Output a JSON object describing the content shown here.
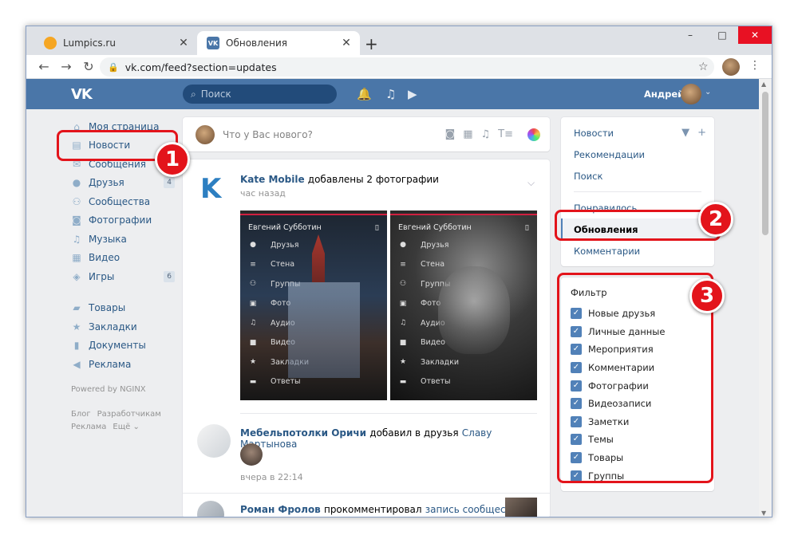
{
  "browser": {
    "tabs": [
      {
        "title": "Lumpics.ru",
        "close": "✕"
      },
      {
        "title": "Обновления",
        "close": "✕"
      }
    ],
    "new_tab": "+",
    "window_controls": {
      "minimize": "–",
      "maximize": "□",
      "close": "✕"
    },
    "nav": {
      "back": "←",
      "forward": "→",
      "reload": "↻"
    },
    "url": "vk.com/feed?section=updates",
    "star": "☆",
    "menu": "⋮"
  },
  "vk_header": {
    "logo": "VK",
    "search_placeholder": "Поиск",
    "username": "Андрей",
    "caret": "⌄",
    "icons": {
      "bell": "🔔",
      "music": "♫",
      "video": "▶"
    }
  },
  "left_menu": {
    "items": [
      {
        "label": "Моя страница",
        "icon": "home-icon",
        "count": ""
      },
      {
        "label": "Новости",
        "icon": "news-icon",
        "count": ""
      },
      {
        "label": "Сообщения",
        "icon": "messages-icon",
        "count": ""
      },
      {
        "label": "Друзья",
        "icon": "friends-icon",
        "count": "4"
      },
      {
        "label": "Сообщества",
        "icon": "communities-icon",
        "count": ""
      },
      {
        "label": "Фотографии",
        "icon": "camera-icon",
        "count": ""
      },
      {
        "label": "Музыка",
        "icon": "music-icon",
        "count": ""
      },
      {
        "label": "Видео",
        "icon": "film-icon",
        "count": ""
      },
      {
        "label": "Игры",
        "icon": "gamepad-icon",
        "count": "6"
      }
    ],
    "items2": [
      {
        "label": "Товары",
        "icon": "bag-icon"
      },
      {
        "label": "Закладки",
        "icon": "star-icon"
      },
      {
        "label": "Документы",
        "icon": "document-icon"
      },
      {
        "label": "Реклама",
        "icon": "megaphone-icon"
      }
    ],
    "powered": "Powered by NGINX",
    "footer": {
      "blog": "Блог",
      "dev": "Разработчикам",
      "ads": "Реклама",
      "more": "Ещё ⌄"
    }
  },
  "composer": {
    "placeholder": "Что у Вас нового?"
  },
  "feed": {
    "post1": {
      "author": "Kate Mobile",
      "action": "добавлены 2 фотографии",
      "time": "час назад",
      "photo_menu": {
        "name": "Евгений Субботин",
        "items": [
          "Друзья",
          "Стена",
          "Группы",
          "Фото",
          "Аудио",
          "Видео",
          "Закладки",
          "Ответы"
        ]
      }
    },
    "post2": {
      "author": "Мебельпотолки Оричи",
      "action": "добавил в друзья",
      "target": "Славу Мартынова",
      "time": "вчера в 22:14"
    },
    "post3": {
      "author": "Роман Фролов",
      "action": "прокомментировал",
      "target": "запись сообщества"
    }
  },
  "right_nav": {
    "group1": [
      "Новости",
      "Рекомендации",
      "Поиск"
    ],
    "group2": [
      "Понравилось",
      "Обновления",
      "Комментарии"
    ],
    "selected": "Обновления"
  },
  "filter": {
    "title": "Фильтр",
    "items": [
      "Новые друзья",
      "Личные данные",
      "Мероприятия",
      "Комментарии",
      "Фотографии",
      "Видеозаписи",
      "Заметки",
      "Темы",
      "Товары",
      "Группы"
    ]
  },
  "annotations": {
    "n1": "1",
    "n2": "2",
    "n3": "3"
  },
  "colors": {
    "vk_blue": "#4a76a8",
    "link": "#2a5885",
    "annotation_red": "#e3141b",
    "checkbox": "#5181b8"
  }
}
